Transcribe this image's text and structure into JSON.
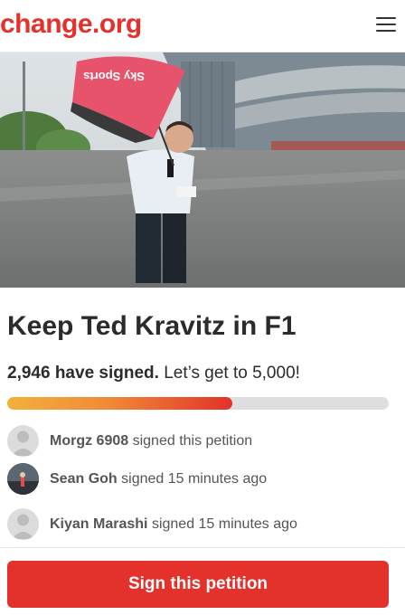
{
  "header": {
    "logo_text": "change.org",
    "menu_icon": "hamburger-menu-icon"
  },
  "hero": {
    "umbrella_text": "Sky Sports"
  },
  "petition": {
    "title": "Keep Ted Kravitz in F1",
    "signed_count": "2,946 have signed.",
    "goal_text": "Let’s get to 5,000!",
    "progress_fraction": 0.589
  },
  "signers": [
    {
      "name": "Morgz 6908",
      "action": "signed this petition",
      "avatar": "default-user-avatar"
    },
    {
      "name": "Sean Goh",
      "action": "signed 15 minutes ago",
      "avatar": "photo-avatar"
    },
    {
      "name": "Kiyan Marashi",
      "action": "signed 15 minutes ago",
      "avatar": "default-user-avatar"
    }
  ],
  "cta": {
    "button_label": "Sign this petition"
  },
  "colors": {
    "brand": "#e4312b",
    "progress_start": "#f2b03c",
    "progress_track": "#dedede"
  }
}
